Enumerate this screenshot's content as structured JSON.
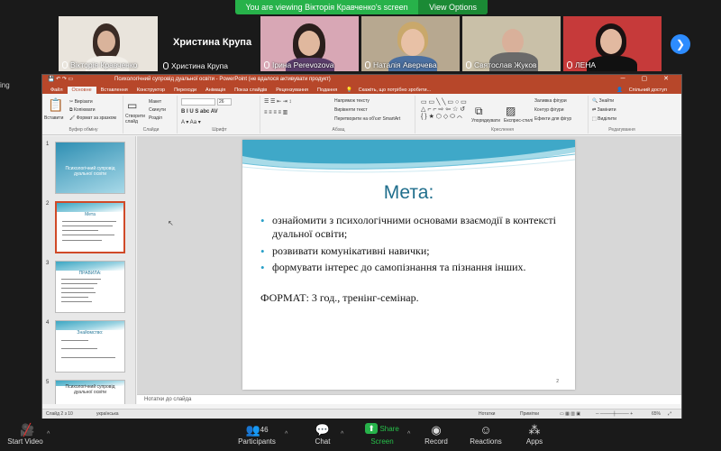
{
  "banner": {
    "message": "You are viewing Вікторія Кравченко's screen",
    "view_options": "View Options"
  },
  "participants": [
    {
      "name": "Вікторія Кравченко"
    },
    {
      "name": "Христина Крупа",
      "display": "Христина Крупа"
    },
    {
      "name": "Ірина Perevozova"
    },
    {
      "name": "Наталія Аверчева"
    },
    {
      "name": "Святослав Жуков"
    },
    {
      "name": "ЛЕНА"
    }
  ],
  "left_clip": "ing",
  "ppt": {
    "title_bar": "Психологічний супровід дуальної освіти - PowerPoint (не вдалося активувати продукт)",
    "tabs": [
      "Файл",
      "Основне",
      "Вставлення",
      "Конструктор",
      "Переходи",
      "Анімація",
      "Показ слайдів",
      "Рецензування",
      "Подання"
    ],
    "tell_me": "Скажіть, що потрібно зробити...",
    "share": "Спільний доступ",
    "ribbon": {
      "paste": "Вставити",
      "cut": "Вирізати",
      "copy": "Копіювати",
      "format_painter": "Формат за зразком",
      "clipboard": "Буфер обміну",
      "new_slide": "Створити слайд",
      "layout": "Макет",
      "reset": "Скинути",
      "section": "Розділ",
      "slides": "Слайди",
      "font_size": "26",
      "font": "Шрифт",
      "text_direction": "Напрямок тексту",
      "align_text": "Вирівняти текст",
      "smartart": "Перетворити на об'єкт SmartArt",
      "paragraph": "Абзац",
      "arrange": "Упорядкувати",
      "quick_styles": "Експрес-стилі",
      "shape_fill": "Заливка фігури",
      "shape_outline": "Контур фігури",
      "shape_effects": "Ефекти для фігур",
      "drawing": "Креслення",
      "find": "Знайти",
      "replace": "Замінити",
      "select": "Виділити",
      "editing": "Редагування"
    },
    "thumbnails": [
      {
        "num": "1",
        "text": "Психологічний супровід дуальної освіти"
      },
      {
        "num": "2",
        "text": "Мета"
      },
      {
        "num": "3",
        "text": "ПРАВИЛА:"
      },
      {
        "num": "4",
        "text": "Знайомство:"
      },
      {
        "num": "5",
        "text": "Психологічний супровід дуальної освіти"
      }
    ],
    "slide": {
      "title": "Мета:",
      "bullets": [
        "ознайомити з психологічними основами взаємодії в контексті дуальної освіти;",
        "розвивати комунікативні навички;",
        "формувати інтерес до самопізнання та пізнання інших."
      ],
      "format": "ФОРМАТ: 3 год., тренінг-семінар.",
      "page": "2"
    },
    "notes": "Нотатки до слайда",
    "status": {
      "slide": "Слайд 2 з 10",
      "lang": "українська",
      "notes": "Нотатки",
      "comments": "Примітки",
      "zoom": "65%"
    }
  },
  "toolbar": [
    {
      "label": "Start Video",
      "icon": "video-off-icon"
    },
    {
      "label": "Participants",
      "count": "46",
      "icon": "participants-icon"
    },
    {
      "label": "Chat",
      "icon": "chat-icon"
    },
    {
      "label": "Share Screen",
      "icon": "share-screen-icon"
    },
    {
      "label": "Record",
      "icon": "record-icon"
    },
    {
      "label": "Reactions",
      "icon": "reactions-icon"
    },
    {
      "label": "Apps",
      "icon": "apps-icon"
    }
  ]
}
